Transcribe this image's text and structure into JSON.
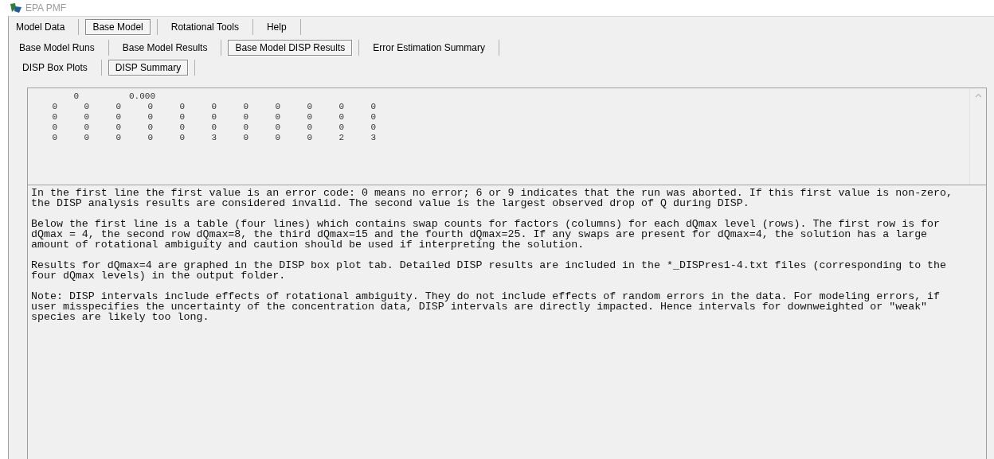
{
  "window": {
    "title": "EPA PMF"
  },
  "main_tabs": [
    {
      "label": "Model Data",
      "selected": false
    },
    {
      "label": "Base Model",
      "selected": true
    },
    {
      "label": "Rotational Tools",
      "selected": false
    },
    {
      "label": "Help",
      "selected": false
    }
  ],
  "sub_tabs": [
    {
      "label": "Base Model Runs",
      "selected": false
    },
    {
      "label": "Base Model Results",
      "selected": false
    },
    {
      "label": "Base Model DISP Results",
      "selected": true
    },
    {
      "label": "Error Estimation Summary",
      "selected": false
    }
  ],
  "disp_tabs": [
    {
      "label": "DISP Box Plots",
      "selected": false
    },
    {
      "label": "DISP Summary",
      "selected": true
    }
  ],
  "output": {
    "error_code": "0",
    "max_drop": "0.000",
    "rows": [
      [
        "0",
        "0",
        "0",
        "0",
        "0",
        "0",
        "0",
        "0",
        "0",
        "0",
        "0"
      ],
      [
        "0",
        "0",
        "0",
        "0",
        "0",
        "0",
        "0",
        "0",
        "0",
        "0",
        "0"
      ],
      [
        "0",
        "0",
        "0",
        "0",
        "0",
        "0",
        "0",
        "0",
        "0",
        "0",
        "0"
      ],
      [
        "0",
        "0",
        "0",
        "0",
        "0",
        "3",
        "0",
        "0",
        "0",
        "2",
        "3"
      ]
    ]
  },
  "explanation": [
    [
      "In the first line the first value is an error code: 0 means no error; 6 or 9 indicates that the run was aborted. If this first value is non-zero,",
      "the DISP analysis results are considered invalid. The second value is the largest observed drop of Q during DISP."
    ],
    [
      "Below the first line is a table (four lines) which contains swap counts for factors (columns) for each dQmax level (rows). The first row is for",
      "dQmax = 4, the second row dQmax=8, the third dQmax=15 and the fourth dQmax=25. If any swaps are present for dQmax=4, the solution has a large",
      "amount of rotational ambiguity and caution should be used if interpreting the solution."
    ],
    [
      "Results for dQmax=4 are graphed in the DISP box plot tab. Detailed DISP results are included in the *_DISPres1-4.txt files (corresponding to the",
      "four dQmax levels) in the output folder."
    ],
    [
      "Note: DISP intervals include effects of rotational ambiguity. They do not include effects of random errors in the data. For modeling errors, if",
      "user misspecifies the uncertainty of the concentration data, DISP intervals are directly impacted. Hence intervals for downweighted or \"weak\"",
      "species are likely too long."
    ]
  ]
}
